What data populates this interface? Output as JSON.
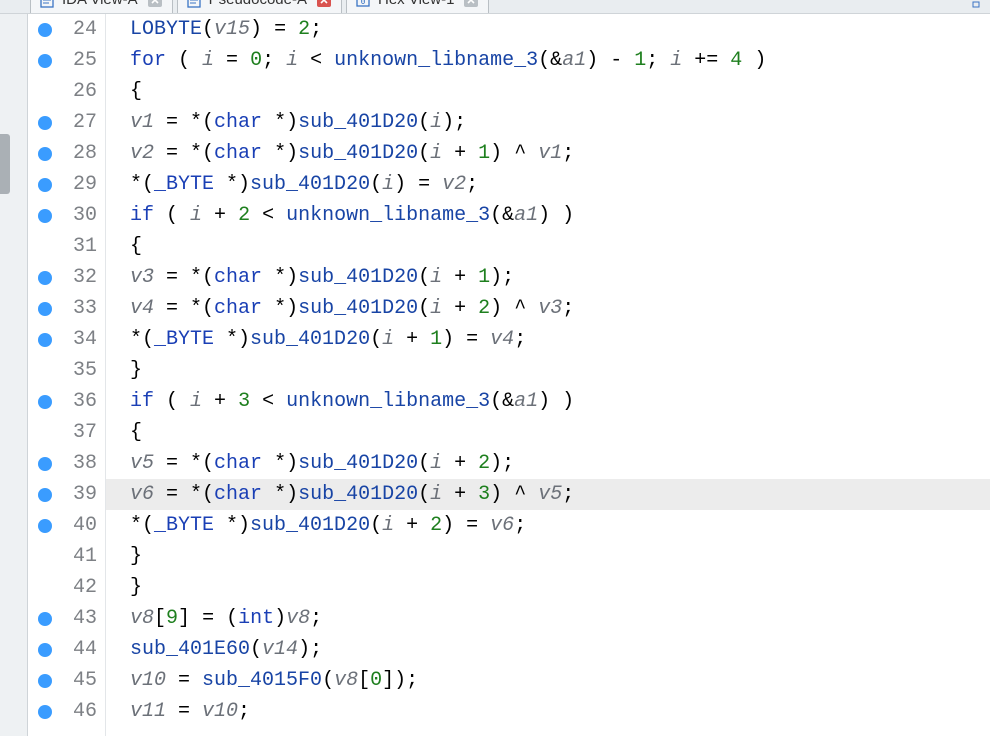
{
  "tabs": {
    "ida": "IDA View-A",
    "pseudo": "Pseudocode-A",
    "hex": "Hex View-1"
  },
  "lines": [
    {
      "n": 24,
      "bp": true,
      "hl": false,
      "indent": 4,
      "tok": [
        [
          "fn",
          "LOBYTE"
        ],
        [
          "pn",
          "("
        ],
        [
          "id",
          "v15"
        ],
        [
          "pn",
          ")"
        ],
        [
          "op",
          " = "
        ],
        [
          "num",
          "2"
        ],
        [
          "pn",
          ";"
        ]
      ]
    },
    {
      "n": 25,
      "bp": true,
      "hl": false,
      "indent": 4,
      "tok": [
        [
          "kw",
          "for"
        ],
        [
          "pn",
          " ( "
        ],
        [
          "id",
          "i"
        ],
        [
          "op",
          " = "
        ],
        [
          "num",
          "0"
        ],
        [
          "pn",
          "; "
        ],
        [
          "id",
          "i"
        ],
        [
          "op",
          " < "
        ],
        [
          "fn",
          "unknown_libname_3"
        ],
        [
          "pn",
          "(&"
        ],
        [
          "id",
          "a1"
        ],
        [
          "pn",
          ")"
        ],
        [
          "op",
          " - "
        ],
        [
          "num",
          "1"
        ],
        [
          "pn",
          "; "
        ],
        [
          "id",
          "i"
        ],
        [
          "op",
          " += "
        ],
        [
          "num",
          "4"
        ],
        [
          "pn",
          " )"
        ]
      ]
    },
    {
      "n": 26,
      "bp": false,
      "hl": false,
      "indent": 4,
      "tok": [
        [
          "pn",
          "{"
        ]
      ]
    },
    {
      "n": 27,
      "bp": true,
      "hl": false,
      "indent": 5,
      "tok": [
        [
          "id",
          "v1"
        ],
        [
          "op",
          " = "
        ],
        [
          "op",
          "*("
        ],
        [
          "ty",
          "char"
        ],
        [
          "op",
          " *)"
        ],
        [
          "fn",
          "sub_401D20"
        ],
        [
          "pn",
          "("
        ],
        [
          "id",
          "i"
        ],
        [
          "pn",
          ");"
        ]
      ]
    },
    {
      "n": 28,
      "bp": true,
      "hl": false,
      "indent": 5,
      "tok": [
        [
          "id",
          "v2"
        ],
        [
          "op",
          " = "
        ],
        [
          "op",
          "*("
        ],
        [
          "ty",
          "char"
        ],
        [
          "op",
          " *)"
        ],
        [
          "fn",
          "sub_401D20"
        ],
        [
          "pn",
          "("
        ],
        [
          "id",
          "i"
        ],
        [
          "op",
          " + "
        ],
        [
          "num",
          "1"
        ],
        [
          "pn",
          ")"
        ],
        [
          "op",
          " ^ "
        ],
        [
          "id",
          "v1"
        ],
        [
          "pn",
          ";"
        ]
      ]
    },
    {
      "n": 29,
      "bp": true,
      "hl": false,
      "indent": 5,
      "tok": [
        [
          "op",
          "*("
        ],
        [
          "ty",
          "_BYTE"
        ],
        [
          "op",
          " *)"
        ],
        [
          "fn",
          "sub_401D20"
        ],
        [
          "pn",
          "("
        ],
        [
          "id",
          "i"
        ],
        [
          "pn",
          ")"
        ],
        [
          "op",
          " = "
        ],
        [
          "id",
          "v2"
        ],
        [
          "pn",
          ";"
        ]
      ]
    },
    {
      "n": 30,
      "bp": true,
      "hl": false,
      "indent": 5,
      "tok": [
        [
          "kw",
          "if"
        ],
        [
          "pn",
          " ( "
        ],
        [
          "id",
          "i"
        ],
        [
          "op",
          " + "
        ],
        [
          "num",
          "2"
        ],
        [
          "op",
          " < "
        ],
        [
          "fn",
          "unknown_libname_3"
        ],
        [
          "pn",
          "(&"
        ],
        [
          "id",
          "a1"
        ],
        [
          "pn",
          ") )"
        ]
      ]
    },
    {
      "n": 31,
      "bp": false,
      "hl": false,
      "indent": 5,
      "tok": [
        [
          "pn",
          "{"
        ]
      ]
    },
    {
      "n": 32,
      "bp": true,
      "hl": false,
      "indent": 6,
      "tok": [
        [
          "id",
          "v3"
        ],
        [
          "op",
          " = "
        ],
        [
          "op",
          "*("
        ],
        [
          "ty",
          "char"
        ],
        [
          "op",
          " *)"
        ],
        [
          "fn",
          "sub_401D20"
        ],
        [
          "pn",
          "("
        ],
        [
          "id",
          "i"
        ],
        [
          "op",
          " + "
        ],
        [
          "num",
          "1"
        ],
        [
          "pn",
          ");"
        ]
      ]
    },
    {
      "n": 33,
      "bp": true,
      "hl": false,
      "indent": 6,
      "tok": [
        [
          "id",
          "v4"
        ],
        [
          "op",
          " = "
        ],
        [
          "op",
          "*("
        ],
        [
          "ty",
          "char"
        ],
        [
          "op",
          " *)"
        ],
        [
          "fn",
          "sub_401D20"
        ],
        [
          "pn",
          "("
        ],
        [
          "id",
          "i"
        ],
        [
          "op",
          " + "
        ],
        [
          "num",
          "2"
        ],
        [
          "pn",
          ")"
        ],
        [
          "op",
          " ^ "
        ],
        [
          "id",
          "v3"
        ],
        [
          "pn",
          ";"
        ]
      ]
    },
    {
      "n": 34,
      "bp": true,
      "hl": false,
      "indent": 6,
      "tok": [
        [
          "op",
          "*("
        ],
        [
          "ty",
          "_BYTE"
        ],
        [
          "op",
          " *)"
        ],
        [
          "fn",
          "sub_401D20"
        ],
        [
          "pn",
          "("
        ],
        [
          "id",
          "i"
        ],
        [
          "op",
          " + "
        ],
        [
          "num",
          "1"
        ],
        [
          "pn",
          ")"
        ],
        [
          "op",
          " = "
        ],
        [
          "id",
          "v4"
        ],
        [
          "pn",
          ";"
        ]
      ]
    },
    {
      "n": 35,
      "bp": false,
      "hl": false,
      "indent": 5,
      "tok": [
        [
          "pn",
          "}"
        ]
      ]
    },
    {
      "n": 36,
      "bp": true,
      "hl": false,
      "indent": 5,
      "tok": [
        [
          "kw",
          "if"
        ],
        [
          "pn",
          " ( "
        ],
        [
          "id",
          "i"
        ],
        [
          "op",
          " + "
        ],
        [
          "num",
          "3"
        ],
        [
          "op",
          " < "
        ],
        [
          "fn",
          "unknown_libname_3"
        ],
        [
          "pn",
          "(&"
        ],
        [
          "id",
          "a1"
        ],
        [
          "pn",
          ") )"
        ]
      ]
    },
    {
      "n": 37,
      "bp": false,
      "hl": false,
      "indent": 5,
      "tok": [
        [
          "pn",
          "{"
        ]
      ]
    },
    {
      "n": 38,
      "bp": true,
      "hl": false,
      "indent": 6,
      "tok": [
        [
          "id",
          "v5"
        ],
        [
          "op",
          " = "
        ],
        [
          "op",
          "*("
        ],
        [
          "ty",
          "char"
        ],
        [
          "op",
          " *)"
        ],
        [
          "fn",
          "sub_401D20"
        ],
        [
          "pn",
          "("
        ],
        [
          "id",
          "i"
        ],
        [
          "op",
          " + "
        ],
        [
          "num",
          "2"
        ],
        [
          "pn",
          ");"
        ]
      ]
    },
    {
      "n": 39,
      "bp": true,
      "hl": true,
      "indent": 6,
      "tok": [
        [
          "id",
          "v6"
        ],
        [
          "op",
          " = "
        ],
        [
          "op",
          "*("
        ],
        [
          "ty",
          "char"
        ],
        [
          "op",
          " *)"
        ],
        [
          "fn",
          "sub_401D20"
        ],
        [
          "pn",
          "("
        ],
        [
          "id",
          "i"
        ],
        [
          "op",
          " + "
        ],
        [
          "num",
          "3"
        ],
        [
          "pn",
          ")"
        ],
        [
          "op",
          " ^ "
        ],
        [
          "id",
          "v5"
        ],
        [
          "pn",
          ";"
        ]
      ]
    },
    {
      "n": 40,
      "bp": true,
      "hl": false,
      "indent": 6,
      "tok": [
        [
          "op",
          "*("
        ],
        [
          "ty",
          "_BYTE"
        ],
        [
          "op",
          " *)"
        ],
        [
          "fn",
          "sub_401D20"
        ],
        [
          "pn",
          "("
        ],
        [
          "id",
          "i"
        ],
        [
          "op",
          " + "
        ],
        [
          "num",
          "2"
        ],
        [
          "pn",
          ")"
        ],
        [
          "op",
          " = "
        ],
        [
          "id",
          "v6"
        ],
        [
          "pn",
          ";"
        ]
      ]
    },
    {
      "n": 41,
      "bp": false,
      "hl": false,
      "indent": 5,
      "tok": [
        [
          "pn",
          "}"
        ]
      ]
    },
    {
      "n": 42,
      "bp": false,
      "hl": false,
      "indent": 4,
      "tok": [
        [
          "pn",
          "}"
        ]
      ]
    },
    {
      "n": 43,
      "bp": true,
      "hl": false,
      "indent": 4,
      "tok": [
        [
          "id",
          "v8"
        ],
        [
          "pn",
          "["
        ],
        [
          "num",
          "9"
        ],
        [
          "pn",
          "]"
        ],
        [
          "op",
          " = "
        ],
        [
          "pn",
          "("
        ],
        [
          "ty",
          "int"
        ],
        [
          "pn",
          ")"
        ],
        [
          "id",
          "v8"
        ],
        [
          "pn",
          ";"
        ]
      ]
    },
    {
      "n": 44,
      "bp": true,
      "hl": false,
      "indent": 4,
      "tok": [
        [
          "fn",
          "sub_401E60"
        ],
        [
          "pn",
          "("
        ],
        [
          "id",
          "v14"
        ],
        [
          "pn",
          ");"
        ]
      ]
    },
    {
      "n": 45,
      "bp": true,
      "hl": false,
      "indent": 4,
      "tok": [
        [
          "id",
          "v10"
        ],
        [
          "op",
          " = "
        ],
        [
          "fn",
          "sub_4015F0"
        ],
        [
          "pn",
          "("
        ],
        [
          "id",
          "v8"
        ],
        [
          "pn",
          "["
        ],
        [
          "num",
          "0"
        ],
        [
          "pn",
          "]);"
        ]
      ]
    },
    {
      "n": 46,
      "bp": true,
      "hl": false,
      "indent": 4,
      "tok": [
        [
          "id",
          "v11"
        ],
        [
          "op",
          " = "
        ],
        [
          "id",
          "v10"
        ],
        [
          "pn",
          ";"
        ]
      ]
    }
  ]
}
